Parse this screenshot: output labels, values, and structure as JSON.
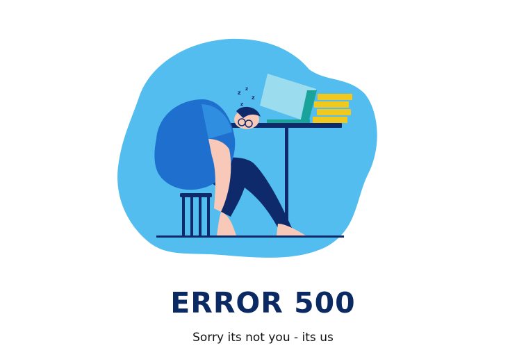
{
  "error": {
    "title": "ERROR 500",
    "subtitle": "Sorry its not you - its us"
  },
  "illustration": {
    "subject": "tired-person-sleeping-at-desk",
    "colors": {
      "blob": "#52bdee",
      "navy": "#0f2a6b",
      "shirt": "#1e6fce",
      "skin": "#f8c9b9",
      "books": "#f1c81d",
      "laptop_screen": "#a8e3ef",
      "laptop_base": "#1aa39b"
    }
  }
}
